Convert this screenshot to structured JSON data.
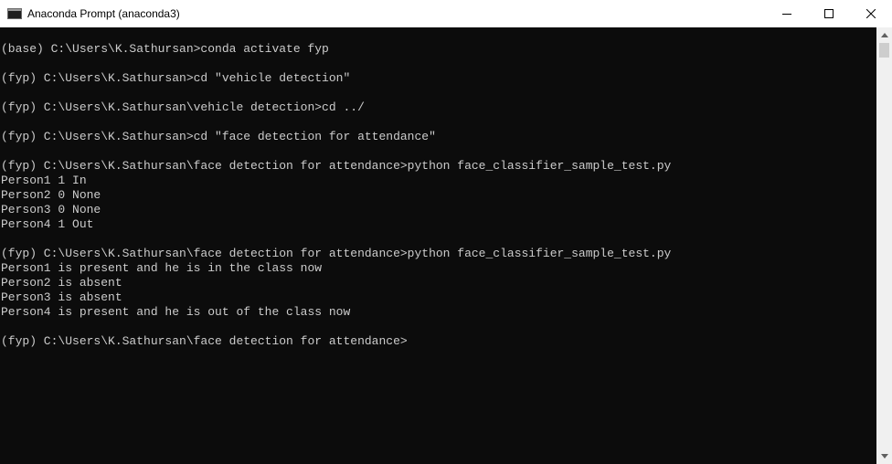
{
  "window": {
    "title": "Anaconda Prompt (anaconda3)",
    "icons": {
      "app": "console-window-icon",
      "minimize": "minimize-icon",
      "maximize": "maximize-icon",
      "close": "close-icon"
    }
  },
  "console": {
    "lines": [
      "(base) C:\\Users\\K.Sathursan>conda activate fyp",
      "",
      "(fyp) C:\\Users\\K.Sathursan>cd \"vehicle detection\"",
      "",
      "(fyp) C:\\Users\\K.Sathursan\\vehicle detection>cd ../",
      "",
      "(fyp) C:\\Users\\K.Sathursan>cd \"face detection for attendance\"",
      "",
      "(fyp) C:\\Users\\K.Sathursan\\face detection for attendance>python face_classifier_sample_test.py",
      "Person1 1 In",
      "Person2 0 None",
      "Person3 0 None",
      "Person4 1 Out",
      "",
      "(fyp) C:\\Users\\K.Sathursan\\face detection for attendance>python face_classifier_sample_test.py",
      "Person1 is present and he is in the class now",
      "Person2 is absent",
      "Person3 is absent",
      "Person4 is present and he is out of the class now",
      "",
      "(fyp) C:\\Users\\K.Sathursan\\face detection for attendance>"
    ]
  },
  "colors": {
    "console_bg": "#0c0c0c",
    "console_fg": "#cccccc",
    "titlebar_bg": "#ffffff",
    "scrollbar_track": "#f0f0f0",
    "scrollbar_thumb": "#cdcdcd"
  }
}
